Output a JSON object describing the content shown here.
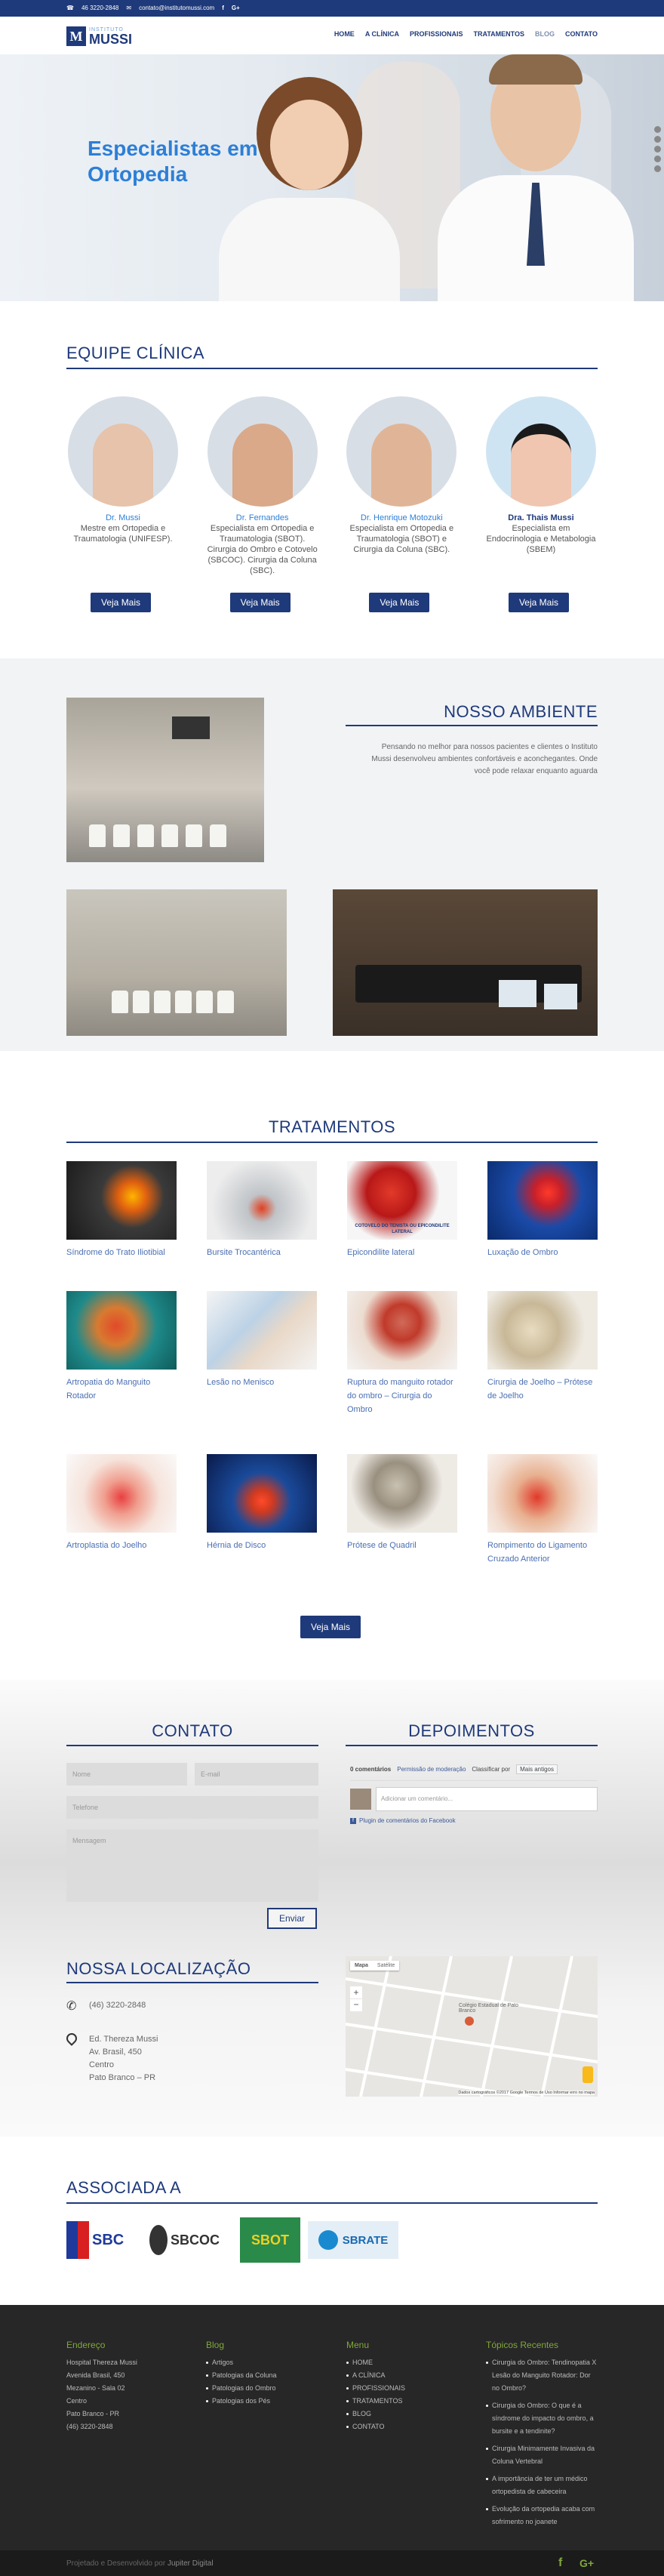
{
  "topbar": {
    "phone": "46 3220-2848",
    "email": "contato@institutomussi.com"
  },
  "header": {
    "logo_small": "INSTITUTO",
    "logo_big": "MUSSI",
    "logo_mark": "M",
    "nav": [
      "HOME",
      "A CLÍNICA",
      "PROFISSIONAIS",
      "TRATAMENTOS",
      "BLOG",
      "CONTATO"
    ]
  },
  "hero": {
    "title": "Especialistas em Ortopedia"
  },
  "team": {
    "title": "EQUIPE CLÍNICA",
    "button": "Veja Mais",
    "members": [
      {
        "name": "Dr. Mussi",
        "desc": "Mestre em Ortopedia e Traumatologia (UNIFESP)."
      },
      {
        "name": "Dr. Fernandes",
        "desc": "Especialista em Ortopedia e Traumatologia (SBOT). Cirurgia do Ombro e Cotovelo (SBCOC). Cirurgia da Coluna (SBC)."
      },
      {
        "name": "Dr. Henrique Motozuki",
        "desc": "Especialista em Ortopedia e Traumatologia (SBOT) e Cirurgia da Coluna (SBC)."
      },
      {
        "name": "Dra. Thais Mussi",
        "desc": "Especialista em Endocrinologia e Metabologia (SBEM)"
      }
    ]
  },
  "ambiente": {
    "title": "NOSSO AMBIENTE",
    "text": "Pensando no melhor para nossos pacientes e clientes o Instituto Mussi desenvolveu ambientes confortáveis e aconchegantes. Onde você pode relaxar enquanto aguarda"
  },
  "tratamentos": {
    "title": "TRATAMENTOS",
    "button": "Veja Mais",
    "items": [
      "Síndrome do Trato Iliotibial",
      "Bursite Trocantérica",
      "Epicondilite lateral",
      "Luxação de Ombro",
      "Artropatia do Manguito Rotador",
      "Lesão no Menisco",
      "Ruptura do manguito rotador do ombro – Cirurgia do Ombro",
      "Cirurgia de Joelho – Prótese de Joelho",
      "Artroplastia do Joelho",
      "Hérnia de Disco",
      "Prótese de Quadril",
      "Rompimento do Ligamento Cruzado Anterior"
    ],
    "img_caption": "COTOVELO DO TENISTA OU EPICONDILITE LATERAL"
  },
  "contato": {
    "title": "CONTATO",
    "name_ph": "Nome",
    "email_ph": "E-mail",
    "phone_ph": "Telefone",
    "msg_ph": "Mensagem",
    "send": "Enviar"
  },
  "depoimentos": {
    "title": "DEPOIMENTOS",
    "count": "0 comentários",
    "perm": "Permissão de moderação",
    "sort_label": "Classificar por",
    "sort_value": "Mais antigos",
    "comment_ph": "Adicionar um comentário...",
    "plugin": "Plugin de comentários do Facebook"
  },
  "local": {
    "title": "NOSSA LOCALIZAÇÃO",
    "phone": "(46) 3220-2848",
    "address": [
      "Ed. Thereza Mussi",
      "Av. Brasil, 450",
      "Centro",
      "Pato Branco – PR"
    ]
  },
  "map": {
    "tab_map": "Mapa",
    "tab_sat": "Satélite",
    "place": "Colégio Estadual de Pato Branco",
    "footer": "Dados cartográficos ©2017 Google   Termos de Uso   Informar erro no mapa"
  },
  "associada": {
    "title": "ASSOCIADA A",
    "logos": [
      "SBC",
      "SBCOC",
      "SBOT",
      "SBRATE"
    ]
  },
  "footer": {
    "endereco": {
      "title": "Endereço",
      "lines": [
        "Hospital Thereza Mussi",
        "Avenida Brasil, 450",
        "Mezanino - Sala 02",
        "Centro",
        "Pato Branco - PR",
        "(46) 3220-2848"
      ]
    },
    "blog": {
      "title": "Blog",
      "items": [
        "Artigos",
        "Patologias da Coluna",
        "Patologias do Ombro",
        "Patologias dos Pés"
      ]
    },
    "menu": {
      "title": "Menu",
      "items": [
        "HOME",
        "A CLÍNICA",
        "PROFISSIONAIS",
        "TRATAMENTOS",
        "BLOG",
        "CONTATO"
      ]
    },
    "topicos": {
      "title": "Tópicos Recentes",
      "items": [
        "Cirurgia do Ombro: Tendinopatia X Lesão do Manguito Rotador: Dor no Ombro?",
        "Cirurgia do Ombro: O que é a síndrome do impacto do ombro, a bursite e a tendinite?",
        "Cirurgia Minimamente Invasiva da Coluna Vertebral",
        "A importância de ter um médico ortopedista de cabeceira",
        "Evolução da ortopedia acaba com sofrimento no joanete"
      ]
    },
    "credit_prefix": "Projetado e Desenvolvido por",
    "credit_name": "Jupiter Digital"
  },
  "colors": {
    "brand": "#1f3a7a",
    "accent": "#2d7fd6",
    "footer_green": "#7fa83b"
  }
}
